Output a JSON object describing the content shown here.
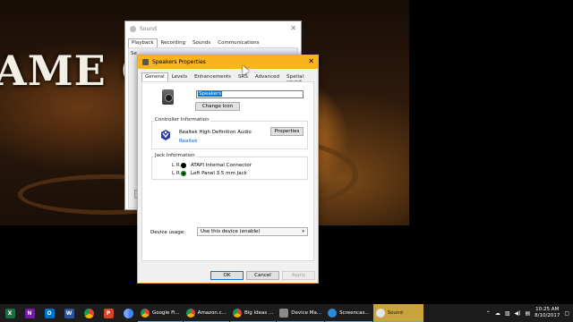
{
  "background": {
    "title_fragment": "AME OF T"
  },
  "sound_window": {
    "title": "Sound",
    "tabs": [
      "Playback",
      "Recording",
      "Sounds",
      "Communications"
    ],
    "active_tab": "Playback",
    "body_fragment": "Se"
  },
  "dialog": {
    "title": "Speakers Properties",
    "tabs": [
      "General",
      "Levels",
      "Enhancements",
      "SRS",
      "Advanced",
      "Spatial sound"
    ],
    "active_tab": "General",
    "device_name": "Speakers",
    "change_icon_label": "Change Icon",
    "controller": {
      "group_label": "Controller Information",
      "name": "Realtek High Definition Audio",
      "vendor_link": "Realtek",
      "properties_label": "Properties"
    },
    "jacks": {
      "group_label": "Jack Information",
      "items": [
        {
          "lr": "L R",
          "name": "ATAPI Internal Connector",
          "color": "#000000"
        },
        {
          "lr": "L R",
          "name": "Left Panel 3.5 mm Jack",
          "color": "#19a319"
        }
      ]
    },
    "usage": {
      "label": "Device usage:",
      "value": "Use this device (enable)"
    },
    "buttons": {
      "ok": "OK",
      "cancel": "Cancel",
      "apply": "Apply"
    }
  },
  "taskbar": {
    "pinned": [
      {
        "icon": "excel-icon",
        "glyph": "X",
        "color": "#1d6f42"
      },
      {
        "icon": "onenote-icon",
        "glyph": "N",
        "color": "#7719aa"
      },
      {
        "icon": "outlook-icon",
        "glyph": "O",
        "color": "#0072c6"
      },
      {
        "icon": "word-icon",
        "glyph": "W",
        "color": "#2b579a"
      },
      {
        "icon": "chrome-icon",
        "glyph": "",
        "color": "#4caf50"
      },
      {
        "icon": "powerpoint-icon",
        "glyph": "P",
        "color": "#d24726"
      },
      {
        "icon": "chrome-blue-icon",
        "glyph": "",
        "color": "#3b78e7"
      }
    ],
    "tasks": [
      {
        "label": "Google Fi...",
        "color": "#4caf50",
        "active": false
      },
      {
        "label": "Amazon.c...",
        "color": "#ff9900",
        "active": false
      },
      {
        "label": "Big Ideas ...",
        "color": "#4a90e2",
        "active": false
      },
      {
        "label": "Device Ma...",
        "color": "#8a8a8a",
        "active": false
      },
      {
        "label": "Screencas...",
        "color": "#2b8ad8",
        "active": false
      },
      {
        "label": "Sound",
        "color": "#b8b8b8",
        "active": true
      }
    ],
    "time": "10:25 AM",
    "date": "8/10/2017"
  }
}
